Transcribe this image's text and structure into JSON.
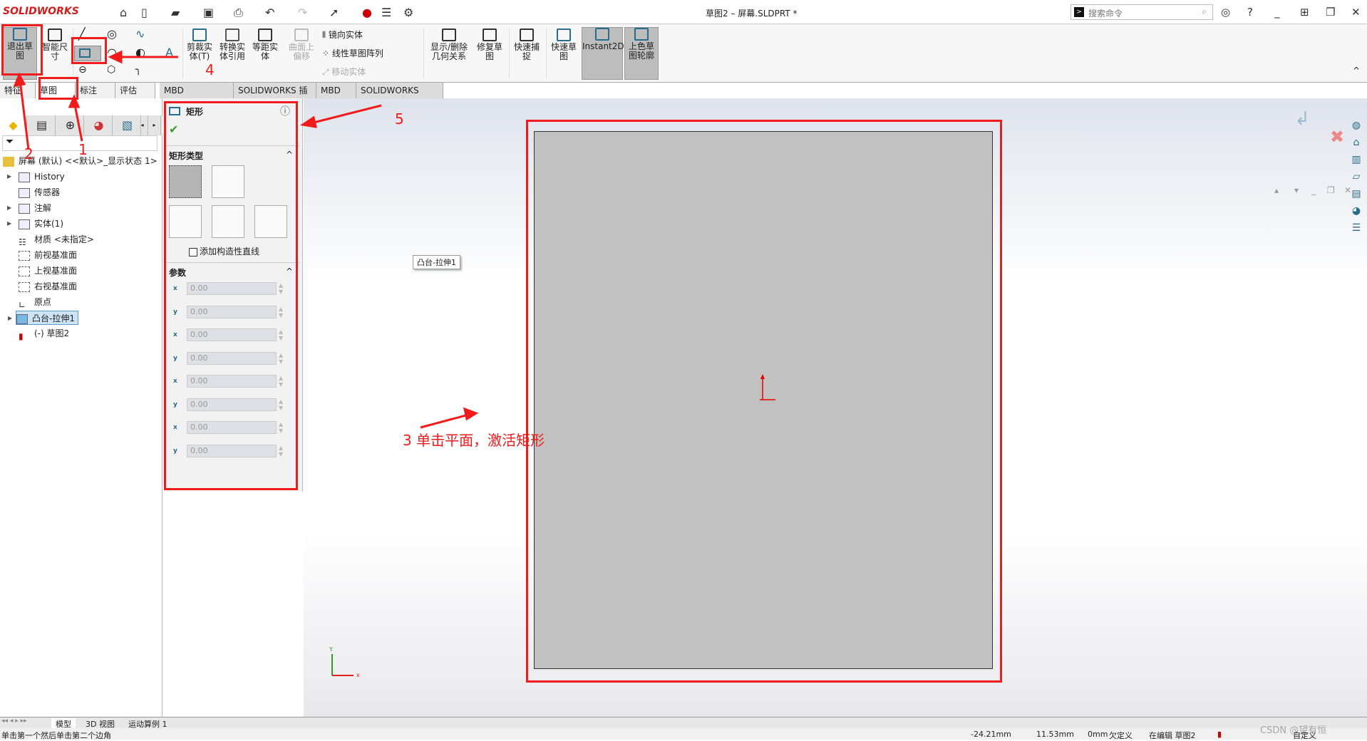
{
  "app": {
    "brand": "SOLIDWORKS",
    "title": "草图2 – 屏幕.SLDPRT *",
    "search_placeholder": "搜索命令"
  },
  "ribbon": {
    "exit_sketch": "退出草图",
    "smart_dim": "智能尺寸",
    "trim": "剪裁实体(T)",
    "convert": "转换实体引用",
    "offset": "等距实体",
    "surface_offset": "曲面上偏移",
    "mirror": "镜向实体",
    "linear_pattern": "线性草图阵列",
    "move": "移动实体",
    "relations": "显示/删除几何关系",
    "repair": "修复草图",
    "quick_snap": "快速捕捉",
    "rapid_sketch": "快速草图",
    "instant2d": "Instant2D",
    "shaded": "上色草图轮廓"
  },
  "tabs": [
    "特征",
    "草图",
    "标注",
    "评估",
    "MBD Dimensions",
    "SOLIDWORKS 插件",
    "MBD",
    "SOLIDWORKS CAM"
  ],
  "tree": {
    "root": "屏幕 (默认) <<默认>_显示状态 1>",
    "items": [
      "History",
      "传感器",
      "注解",
      "实体(1)",
      "材质 <未指定>",
      "前视基准面",
      "上视基准面",
      "右视基准面",
      "原点",
      "凸台-拉伸1",
      "(-) 草图2"
    ]
  },
  "property_manager": {
    "title": "矩形",
    "section_type": "矩形类型",
    "construction_label": "添加构造性直线",
    "construction_checked": false,
    "section_params": "参数",
    "params": [
      {
        "axis": "x",
        "value": "0.00"
      },
      {
        "axis": "y",
        "value": "0.00"
      },
      {
        "axis": "x",
        "value": "0.00"
      },
      {
        "axis": "y",
        "value": "0.00"
      },
      {
        "axis": "x",
        "value": "0.00"
      },
      {
        "axis": "y",
        "value": "0.00"
      },
      {
        "axis": "x",
        "value": "0.00"
      },
      {
        "axis": "y",
        "value": "0.00"
      }
    ]
  },
  "viewport": {
    "tooltip": "凸台-拉伸1",
    "axis_x": "x",
    "axis_y": "Y"
  },
  "annotations": {
    "n1": "1",
    "n2": "2",
    "n3": "3 单击平面，激活矩形",
    "n4": "4",
    "n5": "5",
    "color": "#f21b1b"
  },
  "bottom_tabs": [
    "模型",
    "3D 视图",
    "运动算例 1"
  ],
  "status": {
    "hint": "单击第一个然后单击第二个边角",
    "x": "-24.21mm",
    "y": "11.53mm",
    "z": "0mm",
    "state": "欠定义",
    "editing": "在编辑 草图2",
    "units": "自定义",
    "watermark": "CSDN @望有恒"
  }
}
